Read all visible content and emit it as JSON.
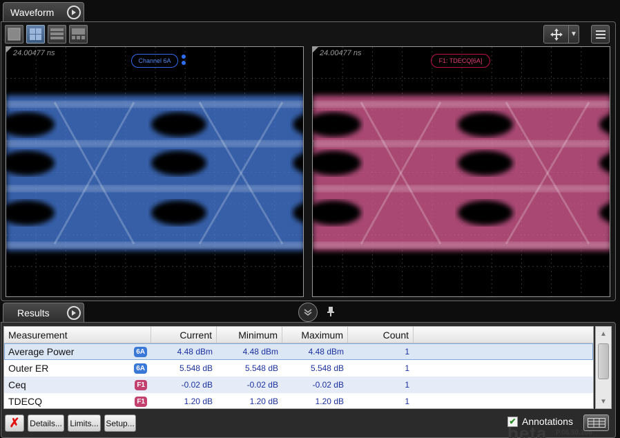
{
  "waveform_tab": {
    "label": "Waveform"
  },
  "toolbar": {
    "layout_buttons": [
      "single",
      "quad",
      "stacked",
      "grid"
    ],
    "nav_icon": "pan-arrows-icon",
    "menu_icon": "hamburger-icon"
  },
  "plots": [
    {
      "timestamp": "24.00477 ns",
      "channel_label": "Channel 6A",
      "color": "#4a7fe0",
      "label_color": "#2b6ef0"
    },
    {
      "timestamp": "24.00477 ns",
      "channel_label": "F1: TDECQ[6A]",
      "color": "#e0609a",
      "label_color": "#e0205a"
    }
  ],
  "results_tab": {
    "label": "Results"
  },
  "table": {
    "headers": [
      "Measurement",
      "Current",
      "Minimum",
      "Maximum",
      "Count"
    ],
    "rows": [
      {
        "name": "Average Power",
        "source": "6A",
        "current": "4.48 dBm",
        "minimum": "4.48 dBm",
        "maximum": "4.48 dBm",
        "count": "1"
      },
      {
        "name": "Outer ER",
        "source": "6A",
        "current": "5.548 dB",
        "minimum": "5.548 dB",
        "maximum": "5.548 dB",
        "count": "1"
      },
      {
        "name": "Ceq",
        "source": "F1",
        "current": "-0.02 dB",
        "minimum": "-0.02 dB",
        "maximum": "-0.02 dB",
        "count": "1"
      },
      {
        "name": "TDECQ",
        "source": "F1",
        "current": "1.20 dB",
        "minimum": "1.20 dB",
        "maximum": "1.20 dB",
        "count": "1"
      }
    ]
  },
  "buttons": {
    "clear": "✗",
    "details": "Details...",
    "limits": "Limits...",
    "setup": "Setup..."
  },
  "annotations": {
    "label": "Annotations",
    "checked": true
  },
  "watermark": {
    "text": "beta",
    "version": "P.06.50.208"
  }
}
